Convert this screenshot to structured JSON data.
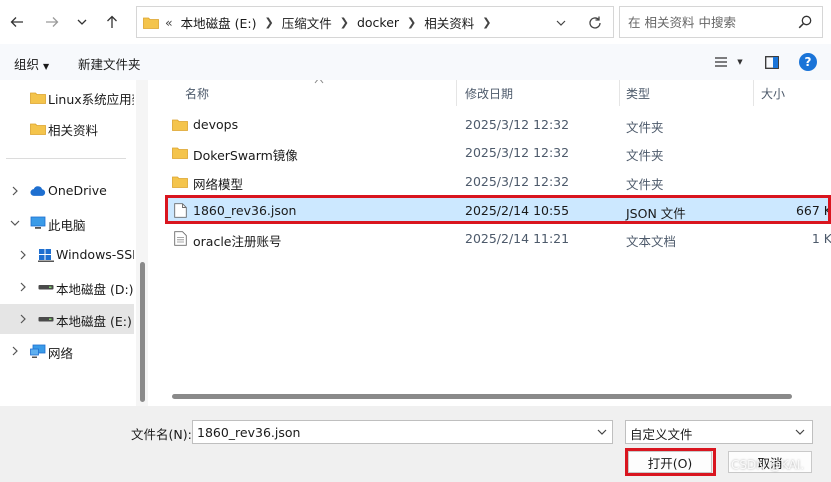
{
  "address": {
    "overflow": "«",
    "crumbs": [
      "本地磁盘 (E:)",
      "压缩文件",
      "docker",
      "相关资料"
    ]
  },
  "search": {
    "placeholder": "在 相关资料 中搜索"
  },
  "toolbar": {
    "organize": "组织",
    "new_folder": "新建文件夹"
  },
  "nav": {
    "items": [
      {
        "label": "Linux系统应用架",
        "icon": "folder-icon"
      },
      {
        "label": "相关资料",
        "icon": "folder-icon"
      },
      {
        "label": "OneDrive",
        "icon": "cloud-icon"
      },
      {
        "label": "此电脑",
        "icon": "computer-icon"
      },
      {
        "label": "Windows-SSD",
        "icon": "drive-icon"
      },
      {
        "label": "本地磁盘 (D:)",
        "icon": "drive-icon"
      },
      {
        "label": "本地磁盘 (E:)",
        "icon": "drive-icon"
      },
      {
        "label": "网络",
        "icon": "network-icon"
      }
    ],
    "selected": "本地磁盘 (E:)"
  },
  "columns": {
    "name": "名称",
    "modified": "修改日期",
    "type": "类型",
    "size": "大小"
  },
  "files": [
    {
      "name": "devops",
      "modified": "2025/3/12 12:32",
      "type": "文件夹",
      "size": "",
      "icon": "folder-icon"
    },
    {
      "name": "DokerSwarm镜像",
      "modified": "2025/3/12 12:32",
      "type": "文件夹",
      "size": "",
      "icon": "folder-icon"
    },
    {
      "name": "网络模型",
      "modified": "2025/3/12 12:32",
      "type": "文件夹",
      "size": "",
      "icon": "folder-icon"
    },
    {
      "name": "1860_rev36.json",
      "modified": "2025/2/14 10:55",
      "type": "JSON 文件",
      "size": "667 K",
      "icon": "file-icon"
    },
    {
      "name": "oracle注册账号",
      "modified": "2025/2/14 11:21",
      "type": "文本文档",
      "size": "1 K",
      "icon": "text-file-icon"
    }
  ],
  "selected_file": "1860_rev36.json",
  "bottom": {
    "filename_label": "文件名(N):",
    "filename_value": "1860_rev36.json",
    "filter": "自定义文件",
    "open": "打开(O)",
    "cancel": "取消"
  },
  "watermark": "CSDN @KAI.",
  "colors": {
    "accent": "#1a74d8",
    "selection": "#cce8ff",
    "highlight_box": "#d9151f"
  }
}
